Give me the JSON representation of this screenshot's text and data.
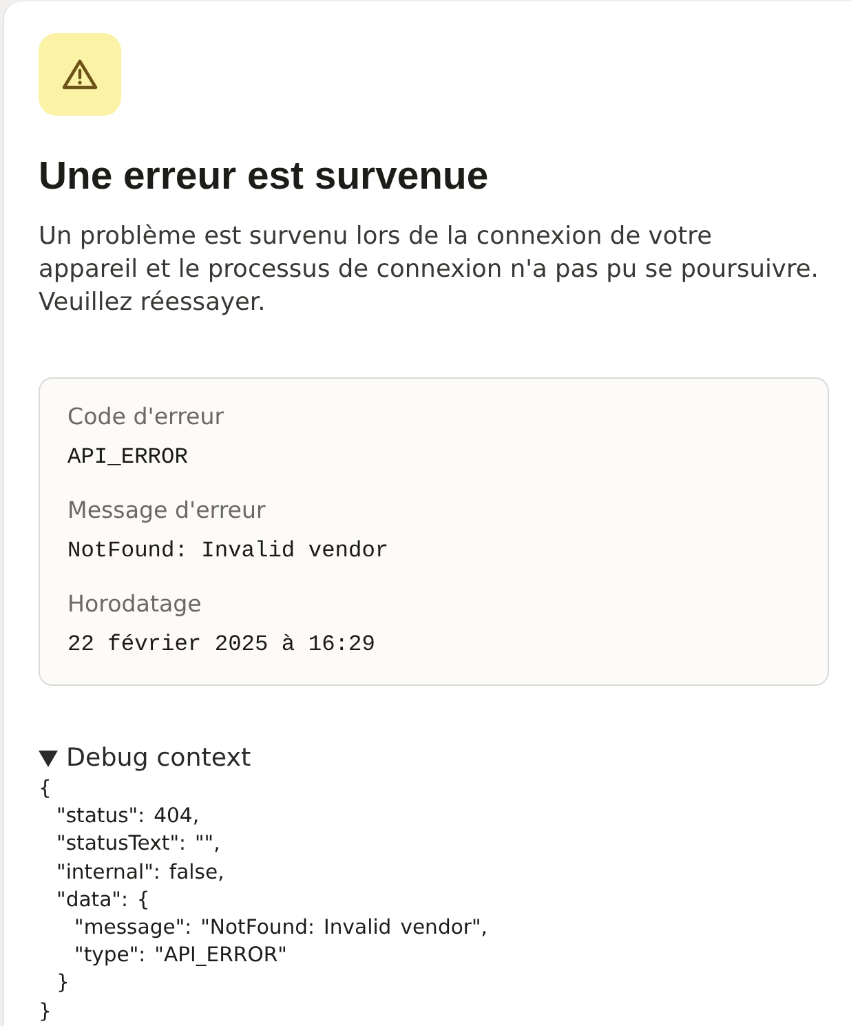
{
  "title": "Une erreur est survenue",
  "description_lines": [
    "Un problème est survenu lors de la connexion de votre",
    "appareil et le processus de connexion n'a pas pu se poursuivre.",
    "Veuillez réessayer."
  ],
  "details": [
    {
      "label": "Code d'erreur",
      "value": "API_ERROR"
    },
    {
      "label": "Message d'erreur",
      "value": "NotFound: Invalid vendor"
    },
    {
      "label": "Horodatage",
      "value": "22 février 2025 à 16:29"
    }
  ],
  "debug": {
    "summary": "Debug context",
    "expanded": true,
    "code": "{\n  \"status\": 404,\n  \"statusText\": \"\",\n  \"internal\": false,\n  \"data\": {\n    \"message\": \"NotFound: Invalid vendor\",\n    \"type\": \"API_ERROR\"\n  }\n}"
  }
}
